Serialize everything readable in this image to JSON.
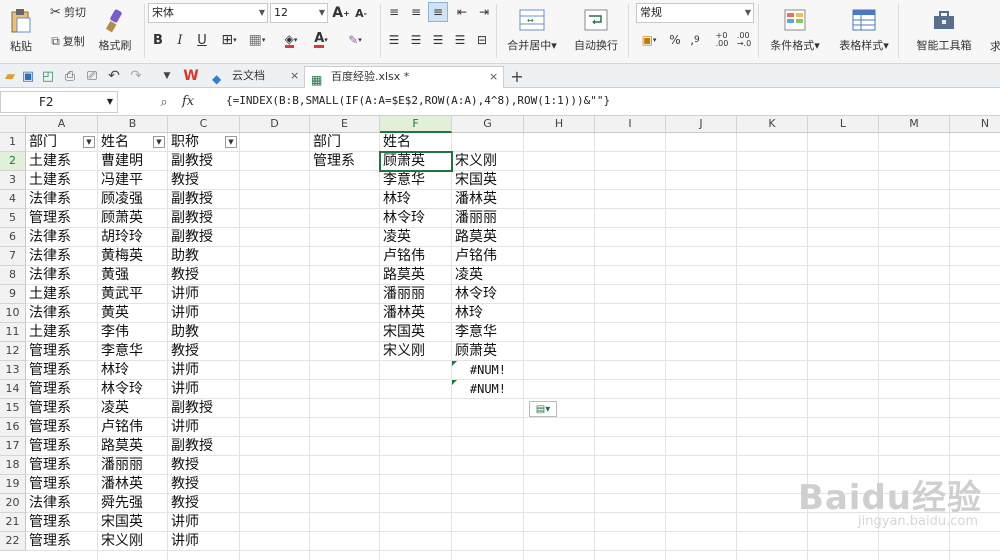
{
  "ribbon": {
    "paste": "粘贴",
    "cut": "剪切",
    "copy": "复制",
    "format_painter": "格式刷",
    "font_name": "宋体",
    "font_size": "12",
    "bold": "B",
    "italic": "I",
    "underline": "U",
    "merge_center": "合并居中",
    "wrap_text": "自动换行",
    "number_format": "常规",
    "percent": "%",
    "comma": "9",
    "conditional_format": "条件格式",
    "table_style": "表格样式",
    "smart_toolbox": "智能工具箱",
    "more": "求"
  },
  "quickbar": {
    "cloud_tab": "云文档",
    "file_tab": "百度经验.xlsx *",
    "new_tab": "+"
  },
  "formula_bar": {
    "name_box": "F2",
    "fx": "fx",
    "formula": "{=INDEX(B:B,SMALL(IF(A:A=$E$2,ROW(A:A),4^8),ROW(1:1)))&\"\"}"
  },
  "grid": {
    "columns": [
      "A",
      "B",
      "C",
      "D",
      "E",
      "F",
      "G",
      "H",
      "I",
      "J",
      "K",
      "L",
      "M",
      "N"
    ],
    "rows": [
      "1",
      "2",
      "3",
      "4",
      "5",
      "6",
      "7",
      "8",
      "9",
      "10",
      "11",
      "12",
      "13",
      "14",
      "15",
      "16",
      "17",
      "18",
      "19",
      "20",
      "21",
      "22"
    ],
    "selected_cell": "F2",
    "col_a": [
      "部门",
      "土建系",
      "土建系",
      "法律系",
      "管理系",
      "法律系",
      "法律系",
      "法律系",
      "土建系",
      "法律系",
      "土建系",
      "管理系",
      "管理系",
      "管理系",
      "管理系",
      "管理系",
      "管理系",
      "管理系",
      "管理系",
      "法律系",
      "管理系",
      "管理系"
    ],
    "col_b": [
      "姓名",
      "曹建明",
      "冯建平",
      "顾凌强",
      "顾萧英",
      "胡玲玲",
      "黄梅英",
      "黄强",
      "黄武平",
      "黄英",
      "李伟",
      "李意华",
      "林玲",
      "林令玲",
      "凌英",
      "卢铭伟",
      "路莫英",
      "潘丽丽",
      "潘林英",
      "舜先强",
      "宋国英",
      "宋义刚"
    ],
    "col_c": [
      "职称",
      "副教授",
      "教授",
      "副教授",
      "副教授",
      "副教授",
      "助教",
      "教授",
      "讲师",
      "讲师",
      "助教",
      "教授",
      "讲师",
      "讲师",
      "副教授",
      "讲师",
      "副教授",
      "教授",
      "教授",
      "教授",
      "讲师",
      "讲师"
    ],
    "col_e": [
      "部门",
      "管理系"
    ],
    "col_f": [
      "姓名",
      "顾萧英",
      "李意华",
      "林玲",
      "林令玲",
      "凌英",
      "卢铭伟",
      "路莫英",
      "潘丽丽",
      "潘林英",
      "宋国英",
      "宋义刚"
    ],
    "col_g": [
      "",
      "宋义刚",
      "宋国英",
      "潘林英",
      "潘丽丽",
      "路莫英",
      "卢铭伟",
      "凌英",
      "林令玲",
      "林玲",
      "李意华",
      "顾萧英",
      "#NUM!",
      "#NUM!"
    ]
  },
  "watermark": {
    "brand": "Baidu经验",
    "url": "jingyan.baidu.com"
  }
}
